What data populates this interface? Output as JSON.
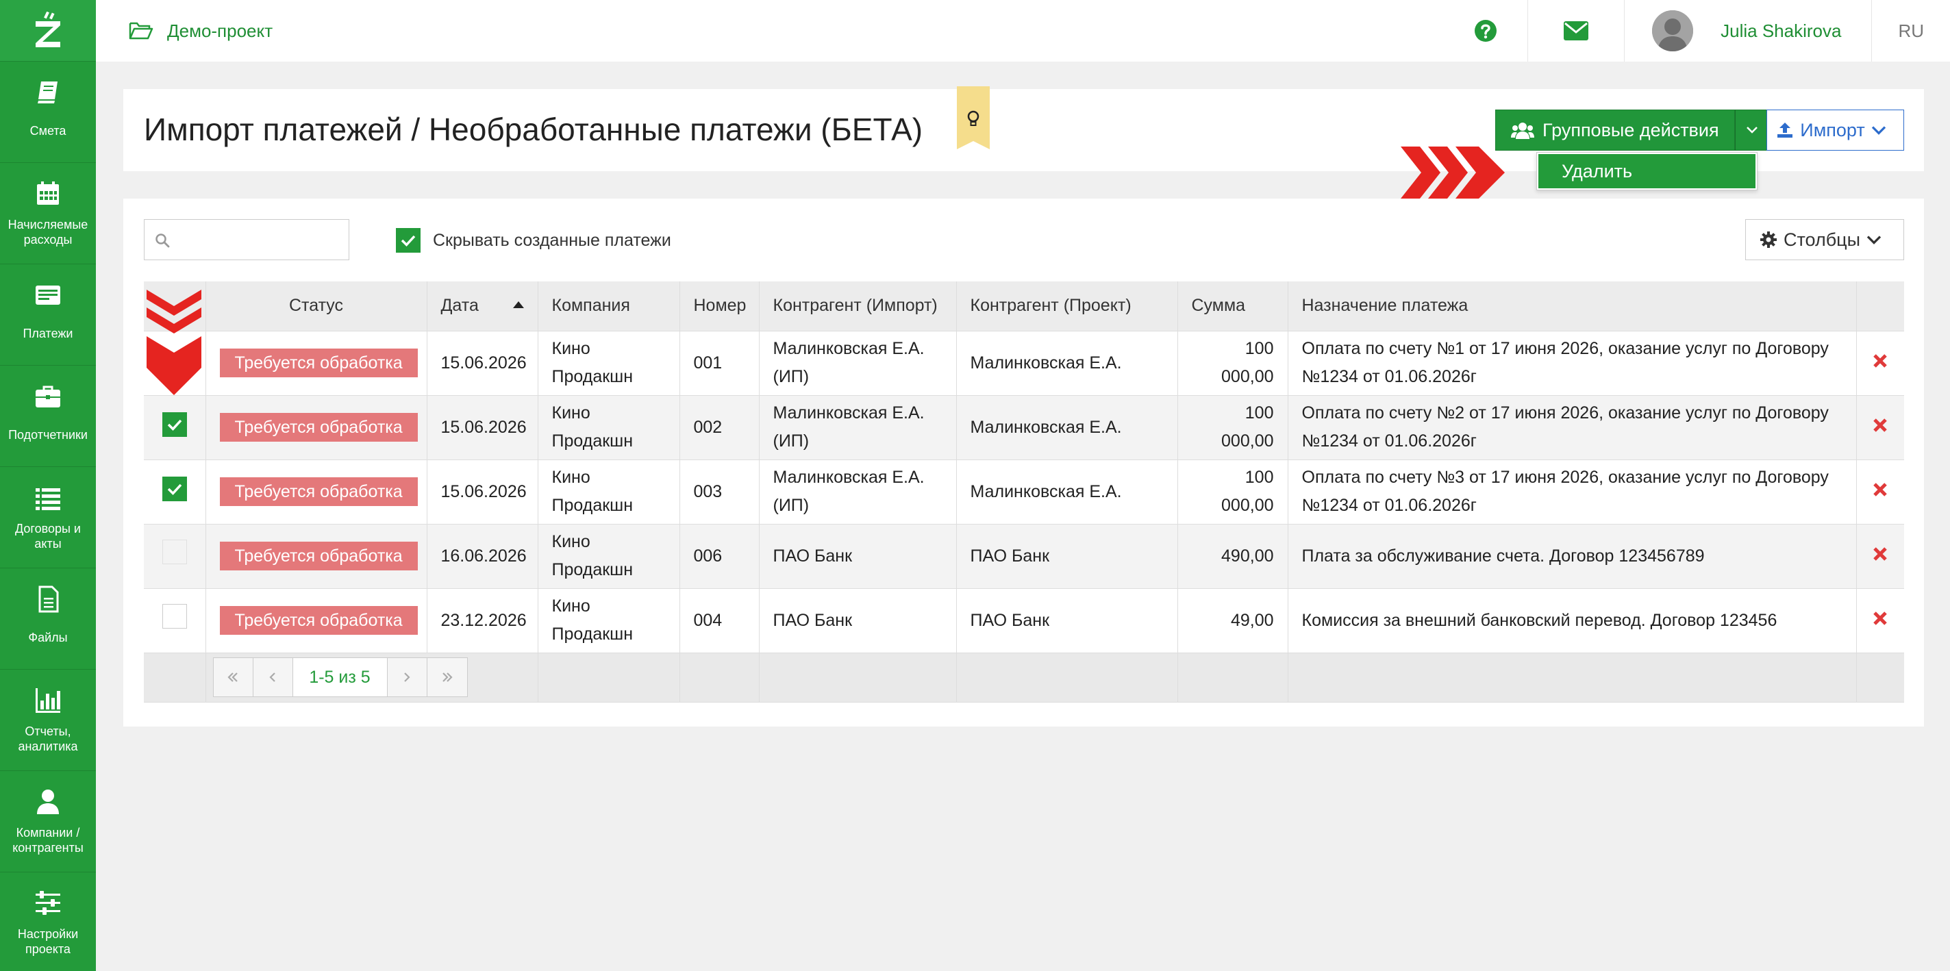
{
  "sidebar": {
    "items": [
      {
        "label": "Смета",
        "icon": "book-icon"
      },
      {
        "label": "Начисляемые расходы",
        "icon": "calendar-icon"
      },
      {
        "label": "Платежи",
        "icon": "card-icon"
      },
      {
        "label": "Подотчетники",
        "icon": "briefcase-icon"
      },
      {
        "label": "Договоры и акты",
        "icon": "list-icon"
      },
      {
        "label": "Файлы",
        "icon": "file-icon"
      },
      {
        "label": "Отчеты, аналитика",
        "icon": "bar-chart-icon"
      },
      {
        "label": "Компании / контрагенты",
        "icon": "user-icon"
      },
      {
        "label": "Настройки проекта",
        "icon": "sliders-icon"
      }
    ]
  },
  "topbar": {
    "project": "Демо-проект",
    "user_name": "Julia Shakirova",
    "lang": "RU"
  },
  "header": {
    "title": "Импорт платежей / Необработанные платежи (БЕТА)",
    "group_actions_label": "Групповые действия",
    "import_label": "Импорт",
    "dropdown_item": "Удалить"
  },
  "toolbar": {
    "search_placeholder": "",
    "hide_created_label": "Скрывать созданные платежи",
    "columns_label": "Столбцы"
  },
  "table": {
    "columns": [
      "Статус",
      "Дата",
      "Компания",
      "Номер",
      "Контрагент (Импорт)",
      "Контрагент (Проект)",
      "Сумма",
      "Назначение платежа"
    ],
    "rows": [
      {
        "checked": null,
        "status": "Требуется обработка",
        "date": "15.06.2026",
        "company": "Кино Продакшн",
        "number": "001",
        "cp_import": "Малинковская Е.А. (ИП)",
        "cp_project": "Малинковская Е.А.",
        "sum": "100 000,00",
        "purpose": "Оплата по счету №1 от 17 июня 2026, оказание услуг по Договору №1234 от 01.06.2026г"
      },
      {
        "checked": true,
        "status": "Требуется обработка",
        "date": "15.06.2026",
        "company": "Кино Продакшн",
        "number": "002",
        "cp_import": "Малинковская Е.А. (ИП)",
        "cp_project": "Малинковская Е.А.",
        "sum": "100 000,00",
        "purpose": "Оплата по счету №2 от 17 июня 2026, оказание услуг по Договору №1234 от 01.06.2026г"
      },
      {
        "checked": true,
        "status": "Требуется обработка",
        "date": "15.06.2026",
        "company": "Кино Продакшн",
        "number": "003",
        "cp_import": "Малинковская Е.А. (ИП)",
        "cp_project": "Малинковская Е.А.",
        "sum": "100 000,00",
        "purpose": "Оплата по счету №3 от 17 июня 2026, оказание услуг по Договору №1234 от 01.06.2026г"
      },
      {
        "checked": false,
        "status": "Требуется обработка",
        "date": "16.06.2026",
        "company": "Кино Продакшн",
        "number": "006",
        "cp_import": "ПАО Банк",
        "cp_project": "ПАО Банк",
        "sum": "490,00",
        "purpose": "Плата за обслуживание счета. Договор 123456789"
      },
      {
        "checked": false,
        "status": "Требуется обработка",
        "date": "23.12.2026",
        "company": "Кино Продакшн",
        "number": "004",
        "cp_import": "ПАО Банк",
        "cp_project": "ПАО Банк",
        "sum": "49,00",
        "purpose": "Комиссия за внешний банковский перевод. Договор 123456"
      }
    ],
    "pager": "1-5 из 5"
  },
  "colors": {
    "brand_green": "#239b3a",
    "badge_red": "#e4787a",
    "delete_red": "#e03a3a",
    "import_blue": "#2d6ccc"
  }
}
